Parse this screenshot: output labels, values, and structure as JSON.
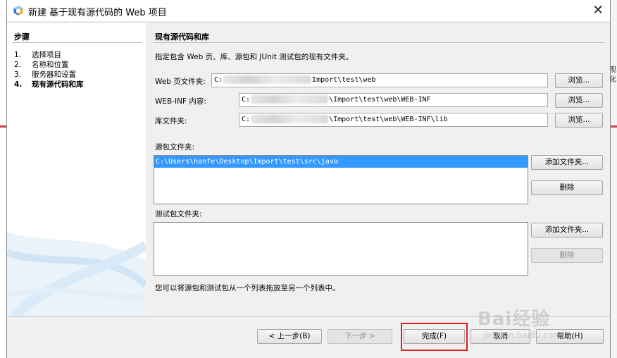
{
  "window": {
    "title": "新建 基于现有源代码的 Web 项目",
    "close_glyph": "✕"
  },
  "steps": {
    "heading": "步骤",
    "items": [
      {
        "num": "1.",
        "label": "选择项目"
      },
      {
        "num": "2.",
        "label": "名称和位置"
      },
      {
        "num": "3.",
        "label": "服务器和设置"
      },
      {
        "num": "4.",
        "label": "现有源代码和库"
      }
    ]
  },
  "content": {
    "heading": "现有源代码和库",
    "description": "指定包含 Web 页、库、源包和 JUnit 测试包的现有文件夹。",
    "web_pages": {
      "label": "Web 页文件夹:",
      "prefix": "C:",
      "suffix": "Import\\test\\web",
      "browse": "浏览..."
    },
    "web_inf": {
      "label": "WEB-INF 内容:",
      "prefix": "C:",
      "suffix": "\\Import\\test\\web\\WEB-INF",
      "browse": "浏览..."
    },
    "libraries": {
      "label": "库文件夹:",
      "prefix": "C:",
      "suffix": "\\Import\\test\\web\\WEB-INF\\lib",
      "browse": "浏览..."
    },
    "source_packages": {
      "label": "源包文件夹:",
      "items": [
        "C:\\Users\\hanfe\\Desktop\\Import\\test\\src\\java"
      ],
      "add": "添加文件夹...",
      "remove": "删除"
    },
    "test_packages": {
      "label": "测试包文件夹:",
      "items": [],
      "add": "添加文件夹...",
      "remove": "删除"
    },
    "hint": "您可以将源包和测试包从一个列表拖放至另一个列表中。"
  },
  "buttons": {
    "back": "< 上一步(B)",
    "next": "下一步 >",
    "finish": "完成(F)",
    "cancel": "取消",
    "help": "帮助(H)"
  },
  "background": {
    "right_text_1": "现",
    "right_text_2": "化"
  },
  "watermark": {
    "text": "Bai经验",
    "sub": "jingyan.baidu.com"
  },
  "colors": {
    "selection": "#3399ff",
    "highlight_box": "#e0201c",
    "titlebar": "#ffffff",
    "dialog_bg": "#f0f0f0"
  }
}
